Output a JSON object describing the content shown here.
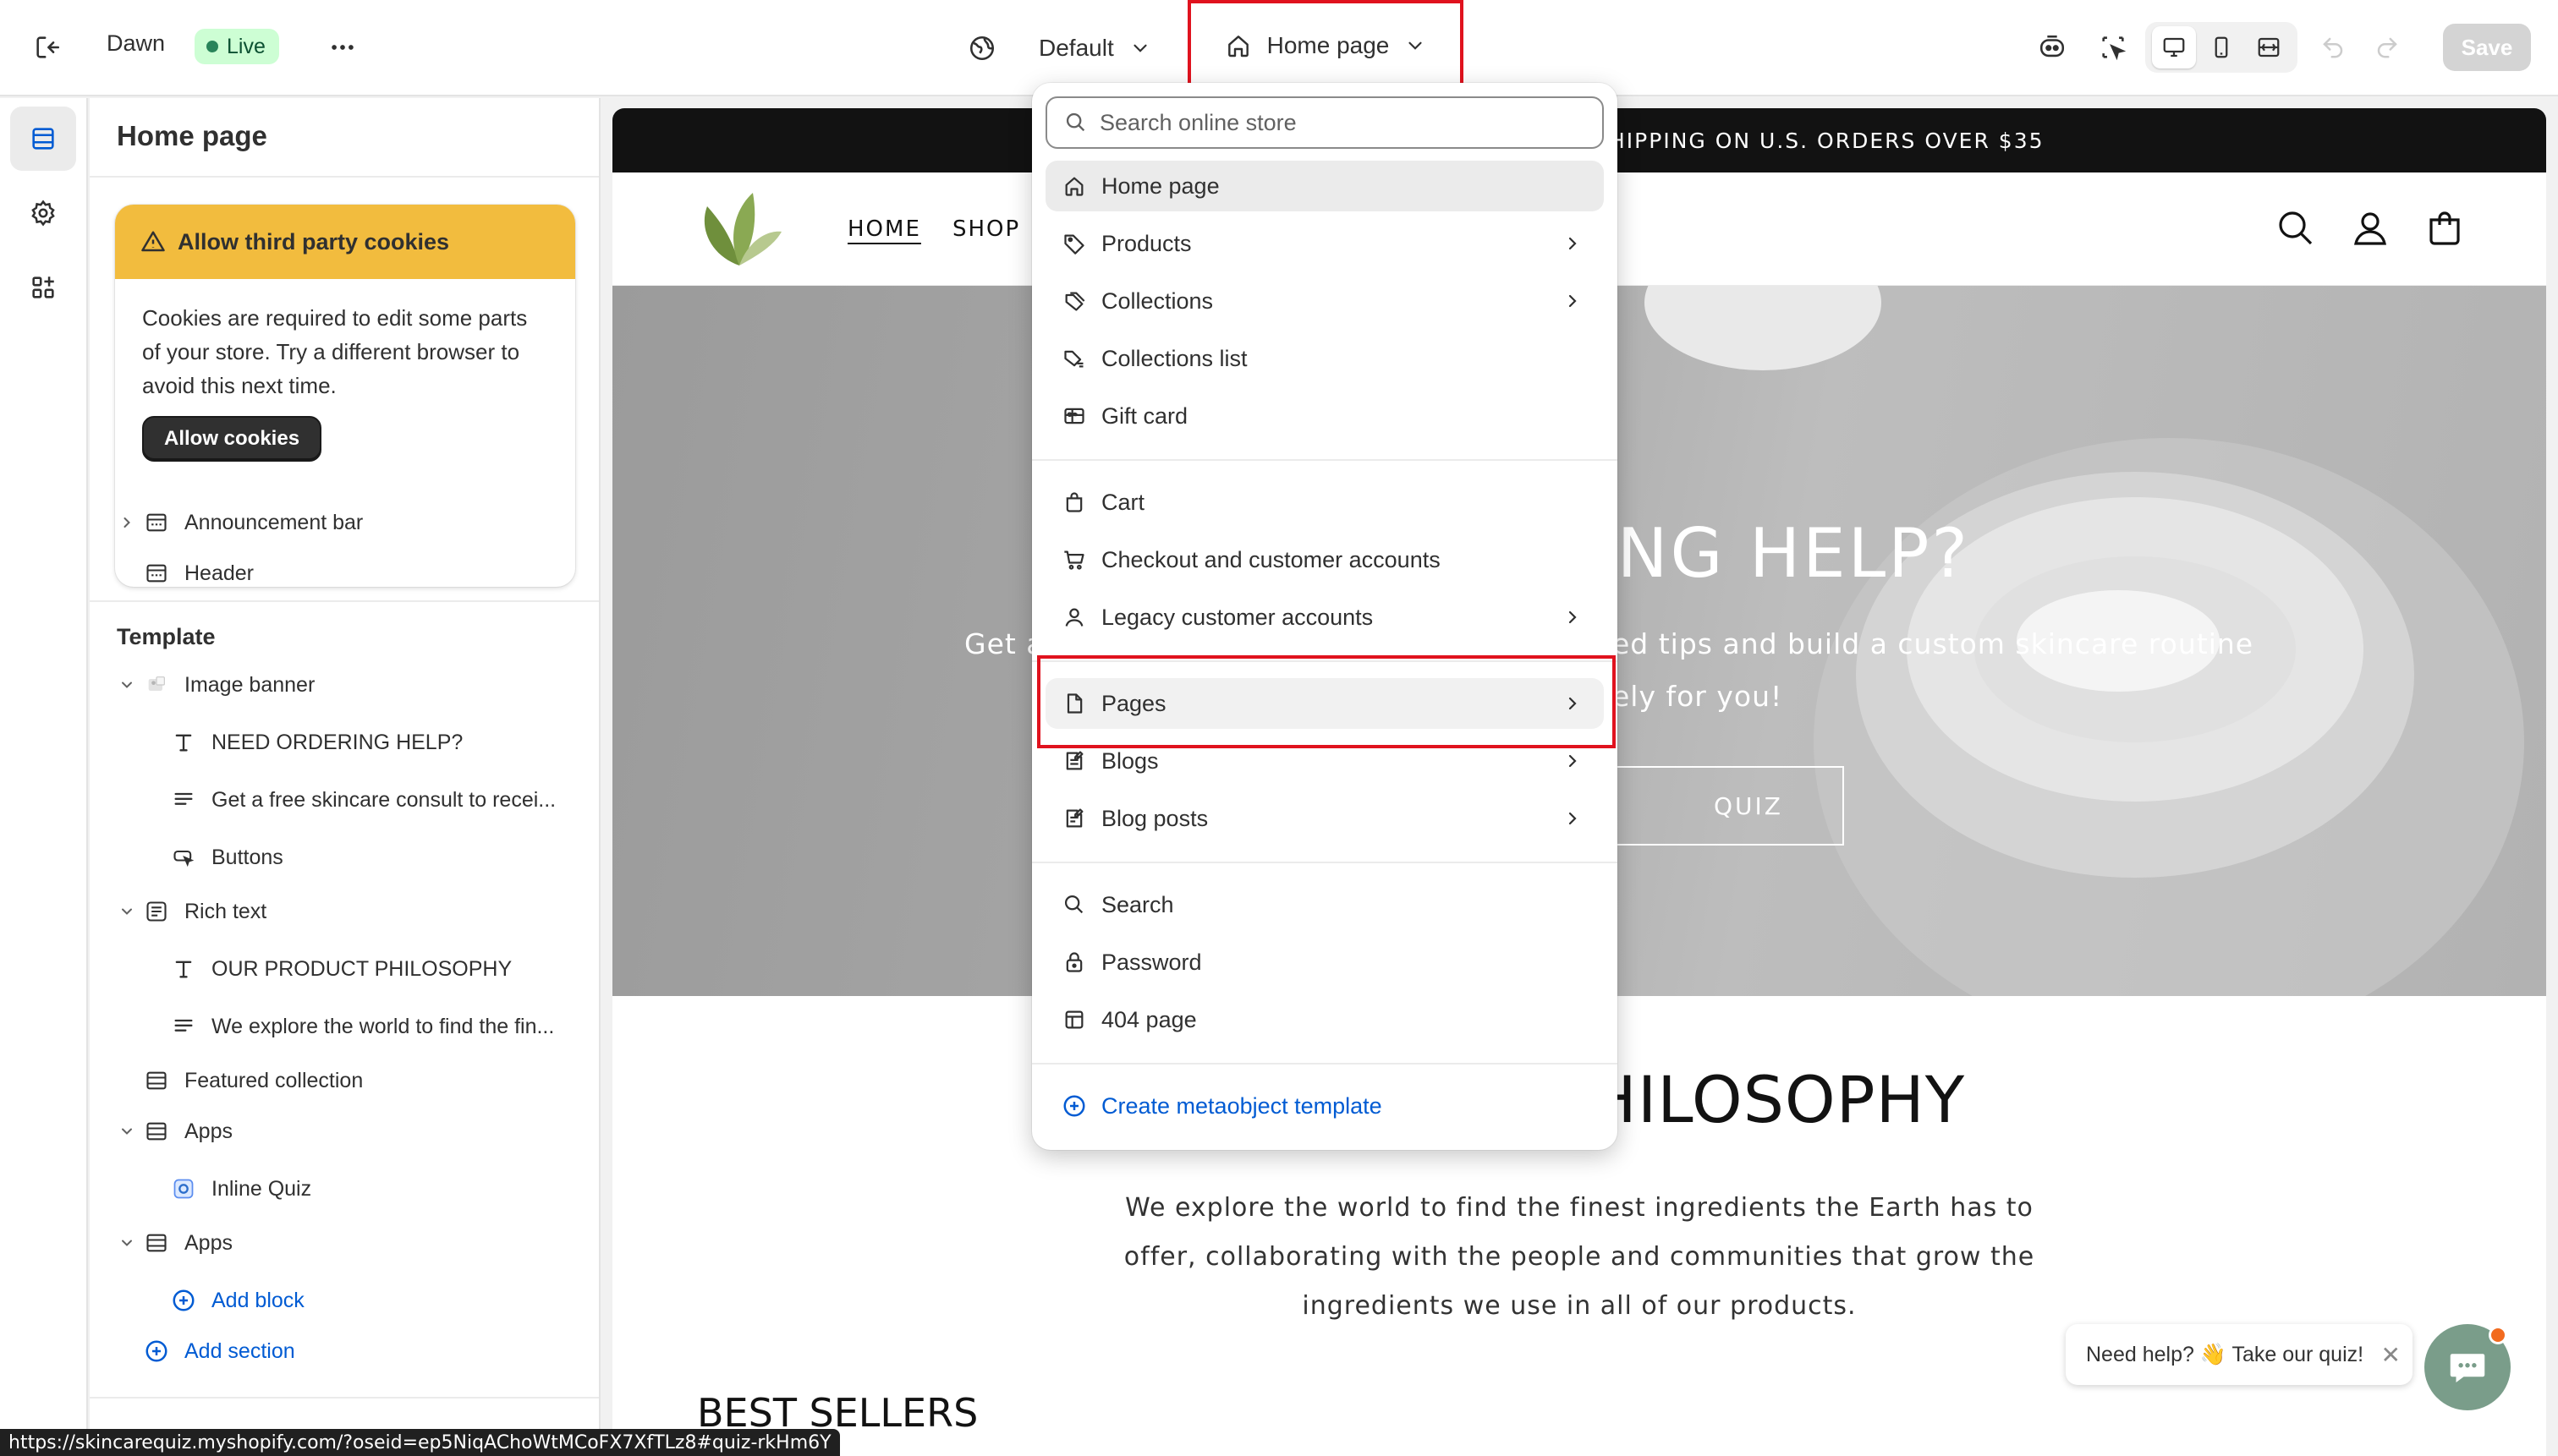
{
  "topbar": {
    "store_name": "Dawn",
    "live_label": "Live",
    "theme_label": "Default",
    "page_selector_label": "Home page",
    "save_label": "Save"
  },
  "sidebar": {
    "title": "Home page",
    "cookie_notice": {
      "title": "Allow third party cookies",
      "body": "Cookies are required to edit some parts of your store. Try a different browser to avoid this next time.",
      "button_label": "Allow cookies"
    },
    "header_group": {
      "announcement_bar": "Announcement bar",
      "header": "Header"
    },
    "template_label": "Template",
    "image_banner": {
      "label": "Image banner",
      "blocks": [
        "NEED ORDERING HELP?",
        "Get a free skincare consult to recei...",
        "Buttons"
      ]
    },
    "rich_text": {
      "label": "Rich text",
      "blocks": [
        "OUR PRODUCT PHILOSOPHY",
        "We explore the world to find the fin..."
      ]
    },
    "featured_collection": "Featured collection",
    "apps_1": {
      "label": "Apps",
      "blocks": [
        "Inline Quiz"
      ]
    },
    "apps_2": {
      "label": "Apps",
      "add_block": "Add block"
    },
    "add_section": "Add section"
  },
  "dropdown": {
    "search_placeholder": "Search online store",
    "items": [
      {
        "label": "Home page",
        "icon": "home-icon",
        "chevron": false,
        "selected": true
      },
      {
        "label": "Products",
        "icon": "tag-icon",
        "chevron": true
      },
      {
        "label": "Collections",
        "icon": "collection-icon",
        "chevron": true
      },
      {
        "label": "Collections list",
        "icon": "collection-list-icon",
        "chevron": false
      },
      {
        "label": "Gift card",
        "icon": "gift-card-icon",
        "chevron": false
      },
      {
        "label": "Cart",
        "icon": "bag-icon",
        "chevron": false
      },
      {
        "label": "Checkout and customer accounts",
        "icon": "cart-icon",
        "chevron": false
      },
      {
        "label": "Legacy customer accounts",
        "icon": "person-icon",
        "chevron": true
      },
      {
        "label": "Pages",
        "icon": "page-icon",
        "chevron": true
      },
      {
        "label": "Blogs",
        "icon": "blog-icon",
        "chevron": true
      },
      {
        "label": "Blog posts",
        "icon": "blog-post-icon",
        "chevron": true
      },
      {
        "label": "Search",
        "icon": "search-icon",
        "chevron": false
      },
      {
        "label": "Password",
        "icon": "lock-icon",
        "chevron": false
      },
      {
        "label": "404 page",
        "icon": "404-page-icon",
        "chevron": false
      }
    ],
    "create_label": "Create metaobject template"
  },
  "preview": {
    "announcement_visible": "HIPPING ON U.S. ORDERS OVER $35",
    "nav": [
      "HOME",
      "SHOP"
    ],
    "banner_title_visible": "ING HELP?",
    "banner_text_left": "Get a",
    "banner_text_line1_visible": "ed tips and build a custom skincare routine",
    "banner_text_line2_visible": "ely for you!",
    "banner_button_visible": "QUIZ",
    "rich_title_visible": "PHILOSOPHY",
    "rich_text": "We explore the world to find the finest ingredients the Earth has to offer, collaborating with the people and communities that grow the ingredients we use in all of our products.",
    "best_sellers": "BEST SELLERS",
    "help_bubble": "Need help? 👋 Take our quiz!"
  },
  "status_url": "https://skincarequiz.myshopify.com/?oseid=ep5NiqAChoWtMCoFX7XfTLz8#quiz-rkHm6Y",
  "colors": {
    "accent_red": "#e0121e",
    "live_badge_bg": "#cdfed4",
    "cookie_banner": "#f2bc3e",
    "link_blue": "#005bd3",
    "announcement_bg": "#121212"
  }
}
